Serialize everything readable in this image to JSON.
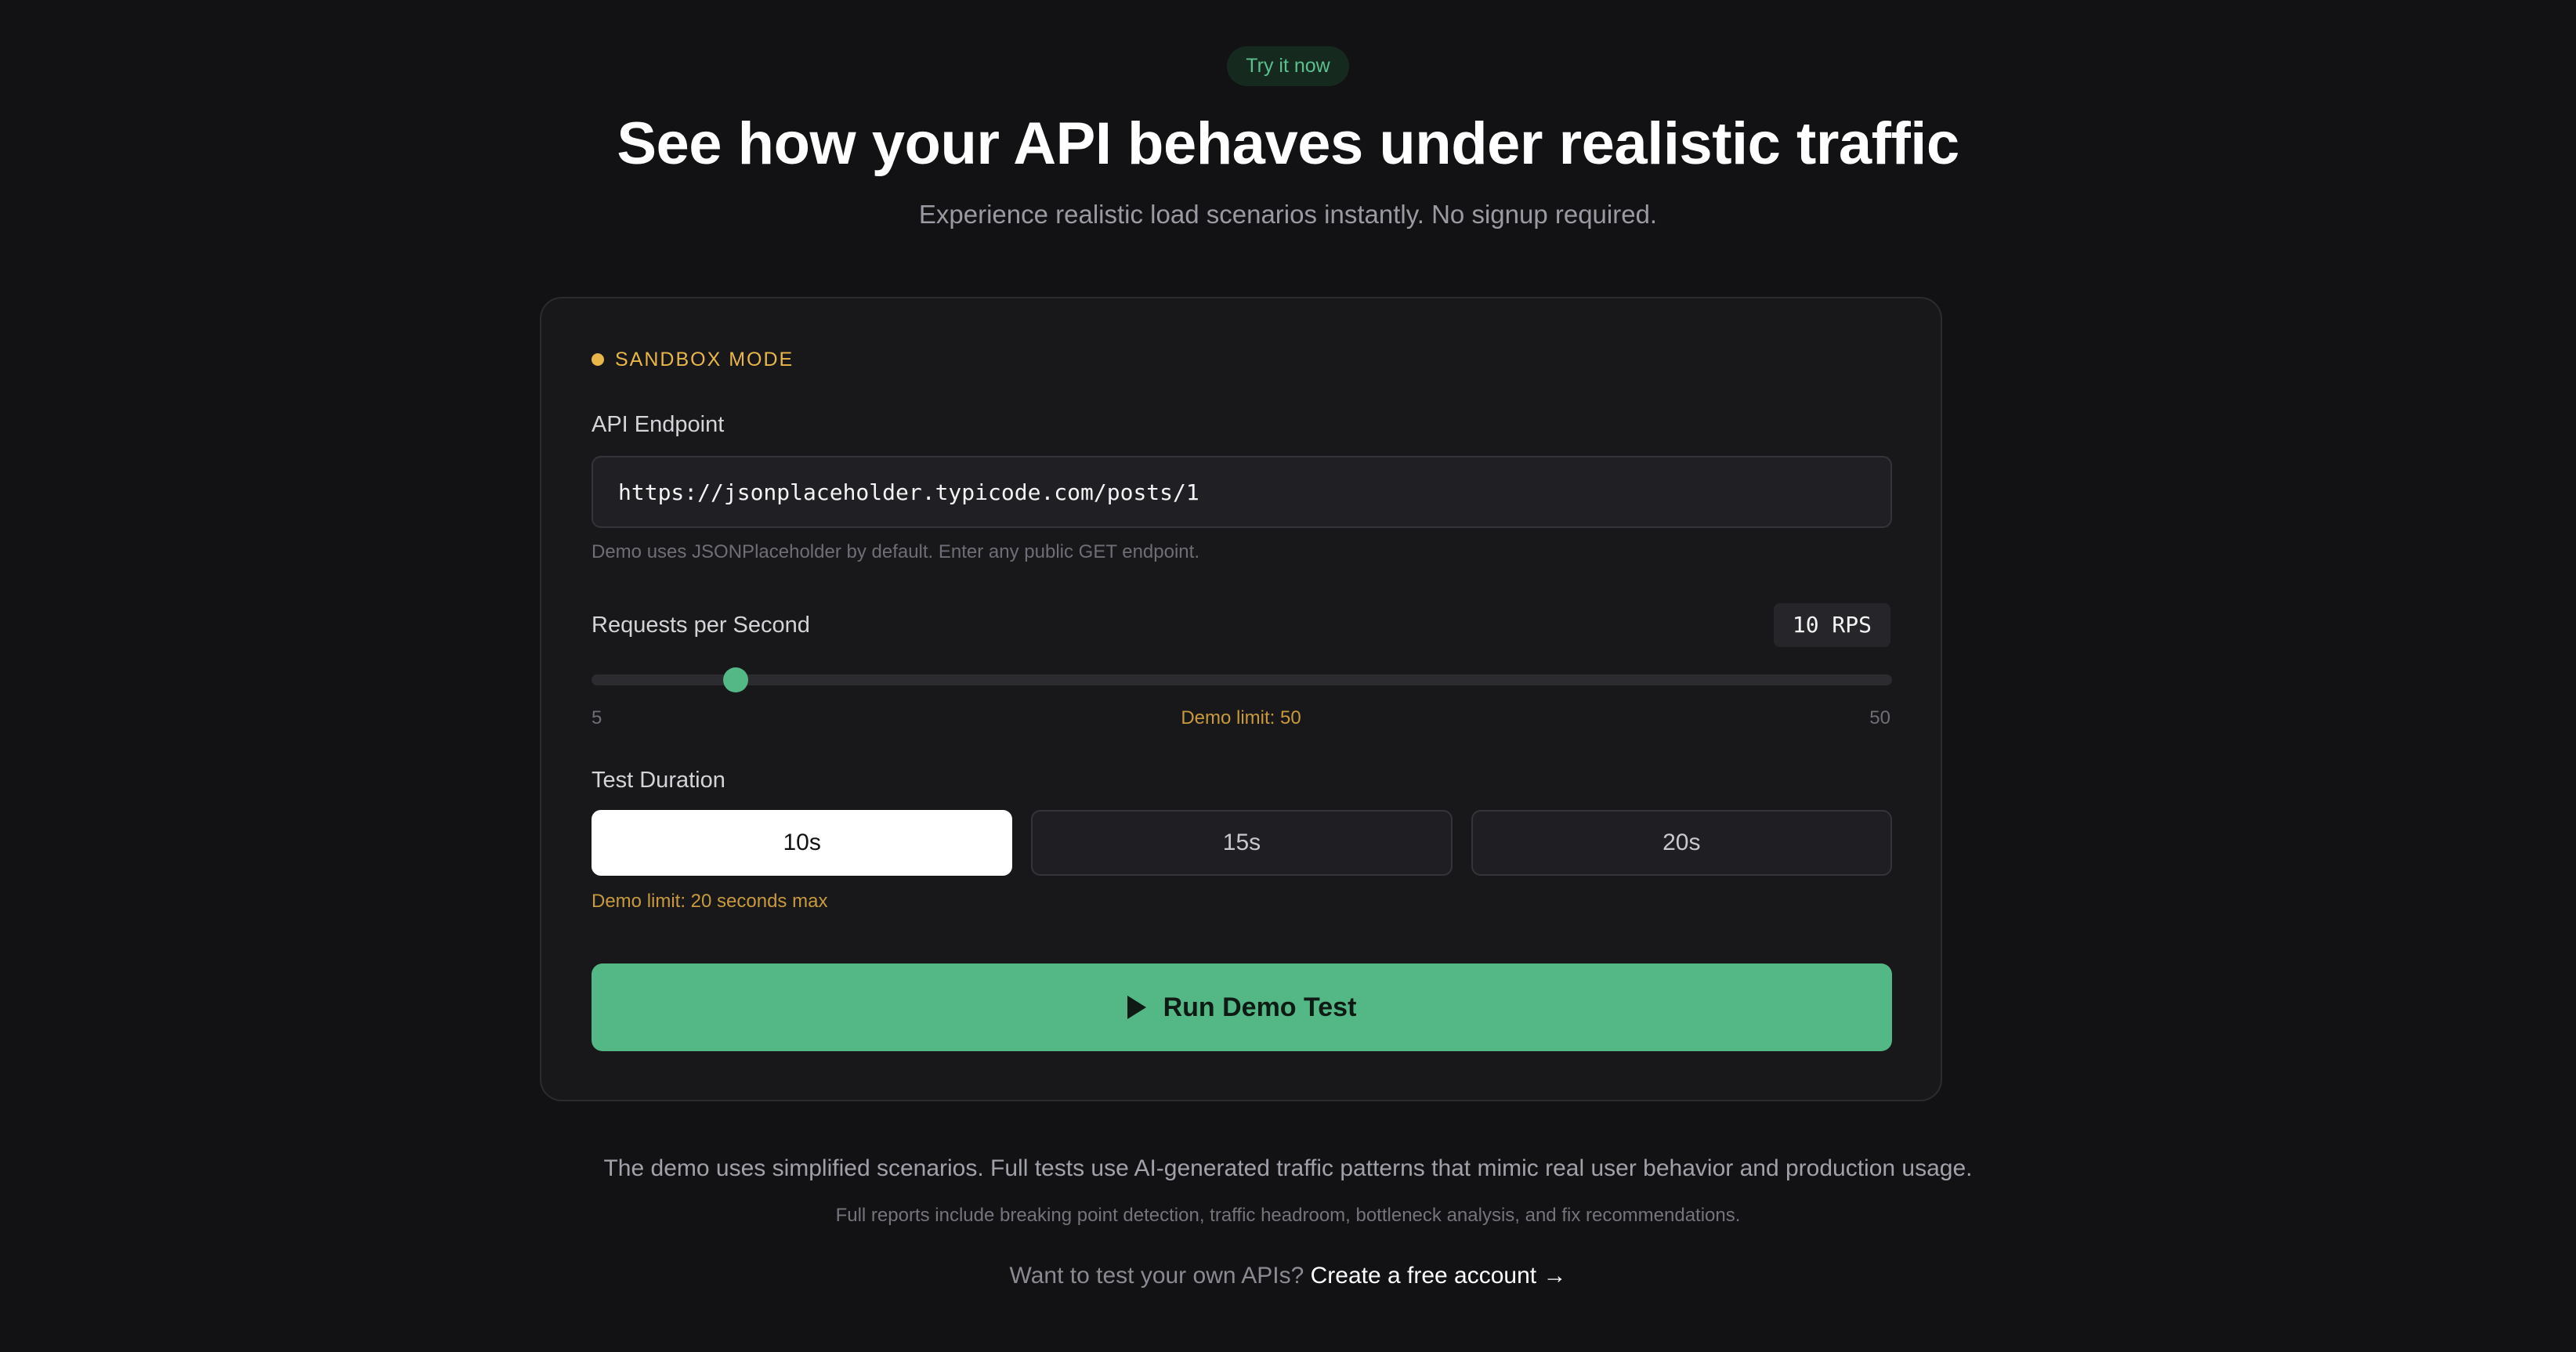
{
  "badge": "Try it now",
  "headline": "See how your API behaves under realistic traffic",
  "subheadline": "Experience realistic load scenarios instantly. No signup required.",
  "card": {
    "mode_label": "SANDBOX MODE",
    "endpoint": {
      "label": "API Endpoint",
      "value": "https://jsonplaceholder.typicode.com/posts/1",
      "hint": "Demo uses JSONPlaceholder by default. Enter any public GET endpoint."
    },
    "rps": {
      "label": "Requests per Second",
      "value_display": "10 RPS",
      "value": 10,
      "min": 5,
      "max": 50,
      "min_label": "5",
      "max_label": "50",
      "limit_label": "Demo limit: 50"
    },
    "duration": {
      "label": "Test Duration",
      "options": [
        "10s",
        "15s",
        "20s"
      ],
      "selected": "10s",
      "hint": "Demo limit: 20 seconds max"
    },
    "run_button": "Run Demo Test"
  },
  "footer": {
    "main": "The demo uses simplified scenarios. Full tests use AI-generated traffic patterns that mimic real user behavior and production usage.",
    "sub": "Full reports include breaking point detection, traffic headroom, bottleneck analysis, and fix recommendations.",
    "cta_prefix": "Want to test your own APIs?",
    "cta_link": "Create a free account →"
  },
  "colors": {
    "background": "#121214",
    "accent_green": "#53b786",
    "warning_amber": "#e9b649"
  }
}
